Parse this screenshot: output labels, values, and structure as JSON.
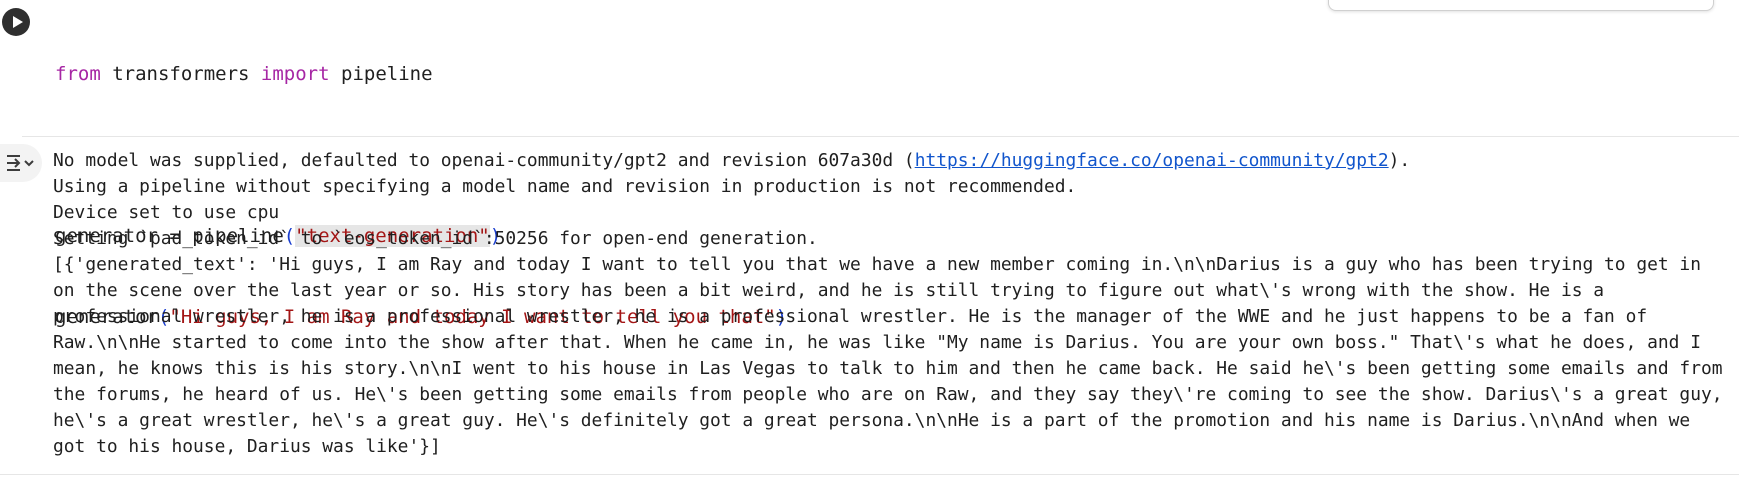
{
  "code": {
    "line1": {
      "kw1": "from",
      "mod": " transformers ",
      "kw2": "import",
      "name": " pipeline"
    },
    "line3": {
      "pre": "generator = pipeline",
      "open": "(",
      "arg": "\"text-generation\"",
      "close": ")"
    },
    "line4": {
      "pre": "generator",
      "open": "(",
      "arg": "\"Hi guys, I am Ray and today I want to tell you that\"",
      "close": ")"
    }
  },
  "output": {
    "line1_pre": "No model was supplied, defaulted to openai-community/gpt2 and revision 607a30d (",
    "line1_link": "https://huggingface.co/openai-community/gpt2",
    "line1_post": ").",
    "line2": "Using a pipeline without specifying a model name and revision in production is not recommended.",
    "line3": "Device set to use cpu",
    "line4": "Setting `pad_token_id` to `eos_token_id`:50256 for open-end generation.",
    "result": "[{'generated_text': 'Hi guys, I am Ray and today I want to tell you that we have a new member coming in.\\n\\nDarius is a guy who has been trying to get in on the scene over the last year or so. His story has been a bit weird, and he is still trying to figure out what\\'s wrong with the show. He is a professional wrestler, he is a professional wrestler, he is a professional wrestler. He is the manager of the WWE and he just happens to be a fan of Raw.\\n\\nHe started to come into the show after that. When he came in, he was like \"My name is Darius. You are your own boss.\" That\\'s what he does, and I mean, he knows this is his story.\\n\\nI went to his house in Las Vegas to talk to him and then he came back. He said he\\'s been getting some emails and from the forums, he heard of us. He\\'s been getting some emails from people who are on Raw, and they say they\\'re coming to see the show. Darius\\'s a great guy, he\\'s a great wrestler, he\\'s a great guy. He\\'s definitely got a great persona.\\n\\nHe is a part of the promotion and his name is Darius.\\n\\nAnd when we got to his house, Darius was like'}]"
  },
  "icons": {
    "run": "play-icon",
    "output": "output-toggle-icon"
  }
}
